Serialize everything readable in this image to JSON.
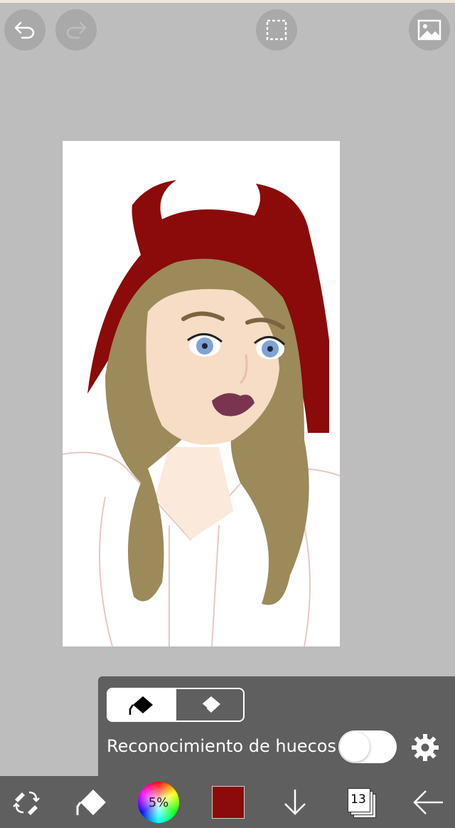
{
  "colors": {
    "background": "#bdbdbd",
    "toolbar": "#5f5f5f",
    "current_color": "#8b0a0a",
    "hat": "#8b0a0a",
    "hair": "#9c8a5a"
  },
  "top_toolbar": {
    "undo_icon": "undo-icon",
    "redo_icon": "redo-icon",
    "selection_icon": "selection-icon",
    "gallery_icon": "image-icon"
  },
  "canvas": {
    "content": "digital drawing of a girl with devil-horn red hood"
  },
  "fill_panel": {
    "fill_mode_icon": "fill-bucket-icon",
    "eraser_mode_icon": "eraser-icon",
    "gap_detection_label": "Reconocimiento de huecos",
    "gap_detection_enabled": false,
    "settings_icon": "gear-icon"
  },
  "bottom_toolbar": {
    "tools_icon": "tool-switch-icon",
    "fill_tool_icon": "fill-bucket-icon",
    "color_wheel_label": "5%",
    "color_swatch": "#8b0a0a",
    "download_icon": "arrow-down-icon",
    "layers_count": "13",
    "back_icon": "arrow-left-icon"
  }
}
